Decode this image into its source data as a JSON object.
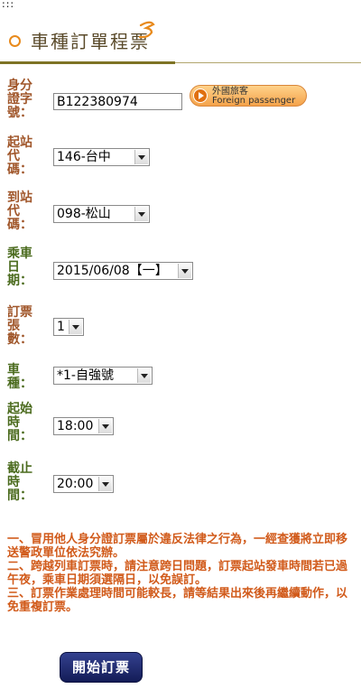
{
  "breadcrumb": ":::",
  "header": {
    "title": "車種訂單程票"
  },
  "form": {
    "person_id": {
      "label": "身分證字號：",
      "value": "B122380974"
    },
    "foreign_button": {
      "line1": "外國旅客",
      "line2": "Foreign passenger"
    },
    "from_station": {
      "label": "起站代碼：",
      "selected": "146-台中"
    },
    "to_station": {
      "label": "到站代碼：",
      "selected": "098-松山"
    },
    "ride_date": {
      "label": "乘車日期：",
      "selected": "2015/06/08【一】"
    },
    "ticket_count": {
      "label": "訂票張數：",
      "selected": "1"
    },
    "train_type": {
      "label": "車種：",
      "selected": "*1-自強號"
    },
    "start_time": {
      "label": "起始時間：",
      "selected": "18:00"
    },
    "end_time": {
      "label": "截止時間：",
      "selected": "20:00"
    }
  },
  "notes": [
    "一、冒用他人身分證訂票屬於違反法律之行為，一經查獲將立即移送警政單位依法究辦。",
    "二、跨越列車訂票時，請注意跨日問題，訂票起站發車時間若已過午夜，乘車日期須選隔日，以免誤訂。",
    "三、訂票作業處理時間可能較長，請等結果出來後再繼續動作，以免重複訂票。"
  ],
  "submit_label": "開始訂票",
  "colors": {
    "label_brown": "#a0562a",
    "label_green": "#4b6b1e",
    "notes": "#d15a1a",
    "button_navy": "#1c2766"
  }
}
